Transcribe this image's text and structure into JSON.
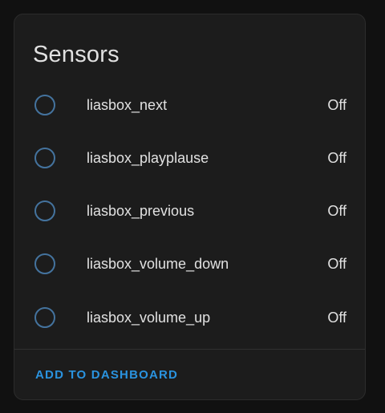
{
  "card": {
    "title": "Sensors",
    "entities": [
      {
        "name": "liasbox_next",
        "state": "Off"
      },
      {
        "name": "liasbox_playplause",
        "state": "Off"
      },
      {
        "name": "liasbox_previous",
        "state": "Off"
      },
      {
        "name": "liasbox_volume_down",
        "state": "Off"
      },
      {
        "name": "liasbox_volume_up",
        "state": "Off"
      }
    ],
    "action_label": "ADD TO DASHBOARD"
  },
  "icons": {
    "entity_state": "radiobox-blank-icon"
  },
  "colors": {
    "background": "#111111",
    "card": "#1c1c1c",
    "icon_ring": "#44739e",
    "text": "#e1e1e1",
    "accent": "#2a93df"
  }
}
